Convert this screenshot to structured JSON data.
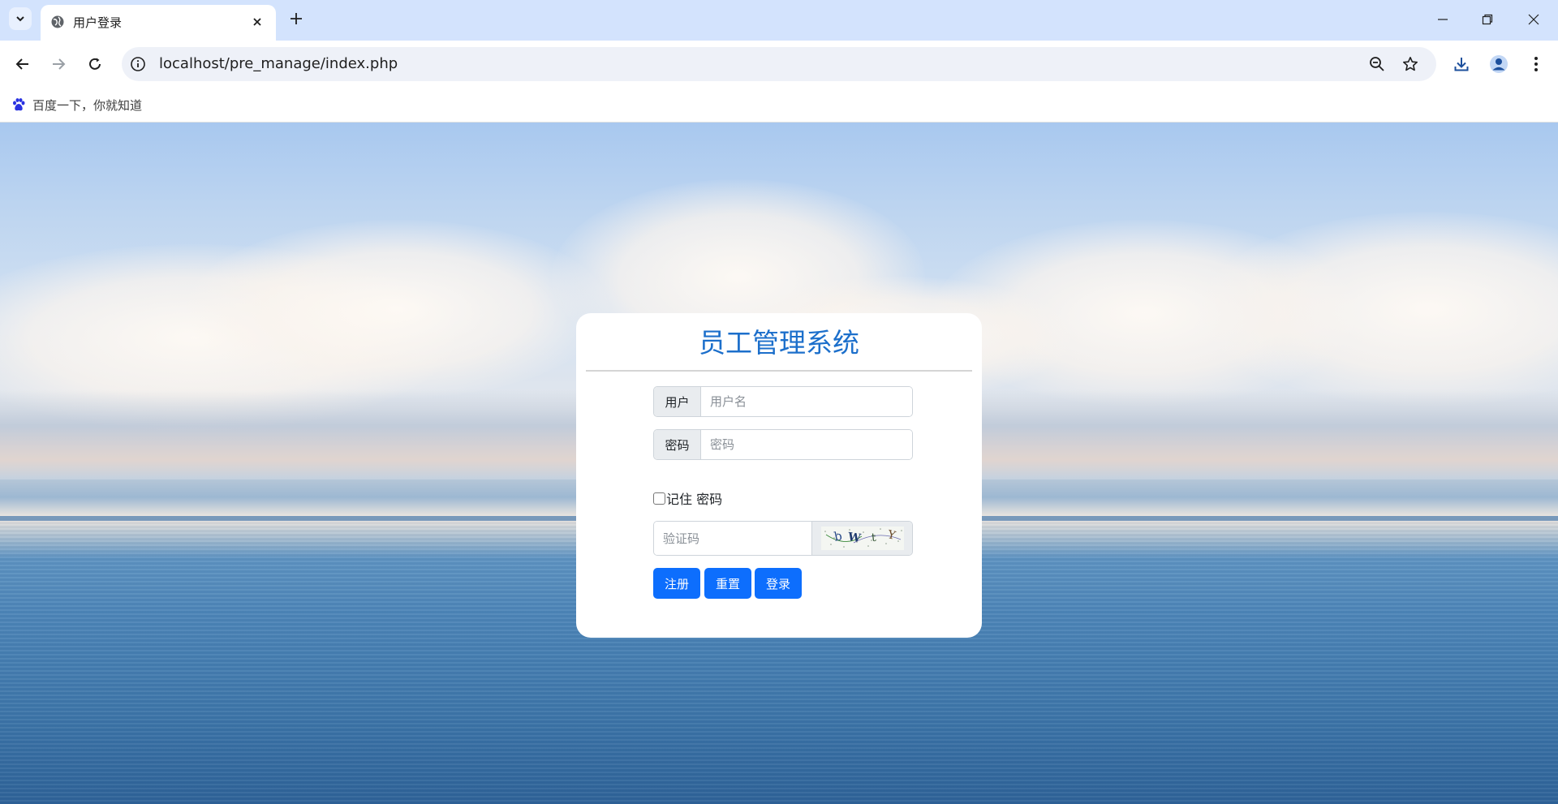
{
  "browser": {
    "tab_title": "用户登录",
    "url": "localhost/pre_manage/index.php",
    "bookmark_label": "百度一下，你就知道"
  },
  "login": {
    "title": "员工管理系统",
    "user_label": "用户",
    "user_placeholder": "用户名",
    "password_label": "密码",
    "password_placeholder": "密码",
    "remember_label": "记住 密码",
    "captcha_placeholder": "验证码",
    "captcha_chars": [
      "b",
      "W",
      "t",
      "Y"
    ],
    "register_label": "注册",
    "reset_label": "重置",
    "login_label": "登录"
  },
  "colors": {
    "title": "#1c6fcb",
    "button": "#0d6efd",
    "tabbar": "#d3e3fd"
  }
}
